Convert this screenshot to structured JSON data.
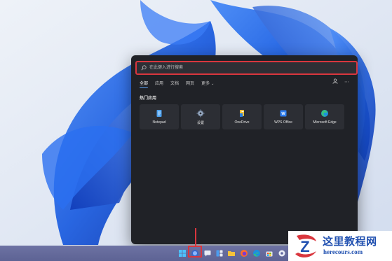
{
  "search": {
    "placeholder": "在此键入进行搜索"
  },
  "tabs": [
    {
      "label": "全部",
      "active": true
    },
    {
      "label": "应用",
      "active": false
    },
    {
      "label": "文档",
      "active": false
    },
    {
      "label": "网页",
      "active": false
    },
    {
      "label": "更多",
      "active": false
    }
  ],
  "panel_icons": [
    "account-icon",
    "more-options-icon"
  ],
  "section": {
    "title": "热门应用"
  },
  "apps": [
    {
      "label": "Notepad",
      "icon": "notepad-icon"
    },
    {
      "label": "设置",
      "icon": "settings-gear-icon"
    },
    {
      "label": "OneDrive",
      "icon": "onedrive-icon"
    },
    {
      "label": "WPS Office",
      "icon": "wps-office-icon"
    },
    {
      "label": "Microsoft Edge",
      "icon": "edge-icon"
    }
  ],
  "taskbar": {
    "icons": [
      "windows-start-icon",
      "search-icon",
      "chat-icon",
      "widgets-icon",
      "file-explorer-icon",
      "firefox-icon",
      "edge-icon",
      "store-icon",
      "settings-icon"
    ]
  },
  "watermark": {
    "title": "这里教程网",
    "url": "herecours.com"
  },
  "colors": {
    "panel_bg": "#202227",
    "tile_bg": "#2c2e34",
    "highlight_red": "#d9363e",
    "taskbar": "#6168a0",
    "watermark_blue": "#2050b0"
  }
}
